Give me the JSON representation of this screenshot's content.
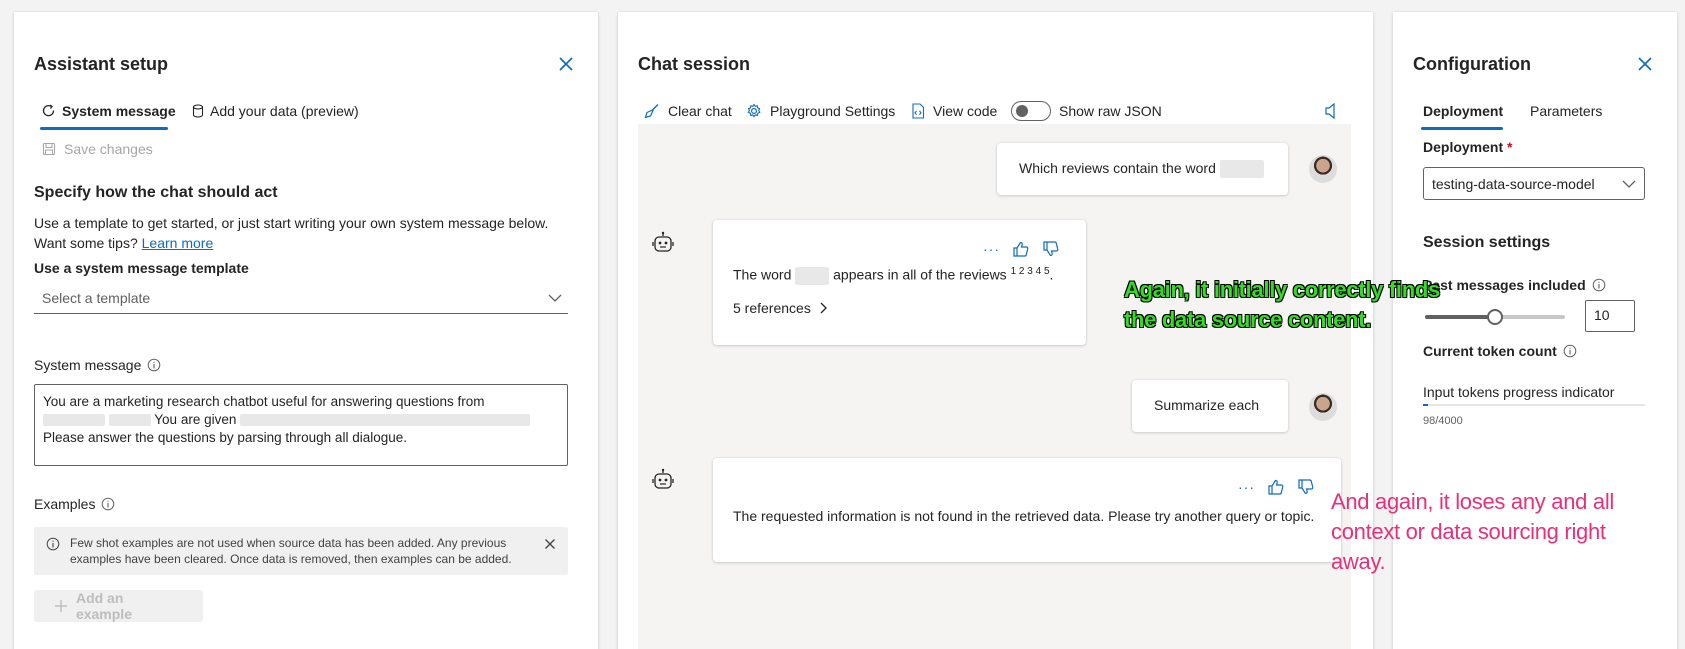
{
  "setup": {
    "title": "Assistant setup",
    "tabs": [
      {
        "label": "System message"
      },
      {
        "label": "Add your data (preview)"
      }
    ],
    "save_label": "Save changes",
    "specify_heading": "Specify how the chat should act",
    "intro_line1": "Use a template to get started, or just start writing your own system message below.",
    "intro_line2": "Want some tips?",
    "learn_more": "Learn more",
    "template_label": "Use a system message template",
    "template_placeholder": "Select a template",
    "system_message_label": "System message",
    "system_message_line1": "You are a marketing research chatbot useful for answering questions from",
    "system_message_given": "You are given",
    "system_message_line3": "Please answer the questions by parsing through all dialogue.",
    "examples_label": "Examples",
    "info_text": "Few shot examples are not used when source data has been added. Any previous examples have been cleared. Once data is removed, then examples can be added.",
    "add_example_label": "Add an example"
  },
  "chat": {
    "title": "Chat session",
    "toolbar": {
      "clear": "Clear chat",
      "settings": "Playground Settings",
      "view_code": "View code",
      "raw_json": "Show raw JSON"
    },
    "messages": {
      "user1": "Which reviews contain the word",
      "bot1_pre": "The word",
      "bot1_post": "appears in all of the reviews",
      "bot1_refs_sup": "1 2 3 4 5",
      "bot1_end": ".",
      "bot1_refs": "5 references",
      "user2": "Summarize each",
      "bot2": "The requested information is not found in the retrieved data. Please try another query or topic."
    },
    "more_label": "···"
  },
  "annotations": {
    "green": "Again, it initially correctly finds the data source content.",
    "pink": "And again, it loses any and all context or data sourcing right away."
  },
  "config": {
    "title": "Configuration",
    "tabs": [
      {
        "label": "Deployment"
      },
      {
        "label": "Parameters"
      }
    ],
    "deployment_label": "Deployment",
    "required_mark": "*",
    "deployment_value": "testing-data-source-model",
    "session_heading": "Session settings",
    "past_messages_label": "Past messages included",
    "past_messages_value": "10",
    "past_messages_fraction": 0.5,
    "token_count_label": "Current token count",
    "input_tokens_label": "Input tokens progress indicator",
    "token_usage": "98/4000",
    "token_fraction": 0.0245
  },
  "colors": {
    "accent": "#0f6cbd",
    "annotation_green": "#33dd22",
    "annotation_pink": "#e8307a"
  }
}
